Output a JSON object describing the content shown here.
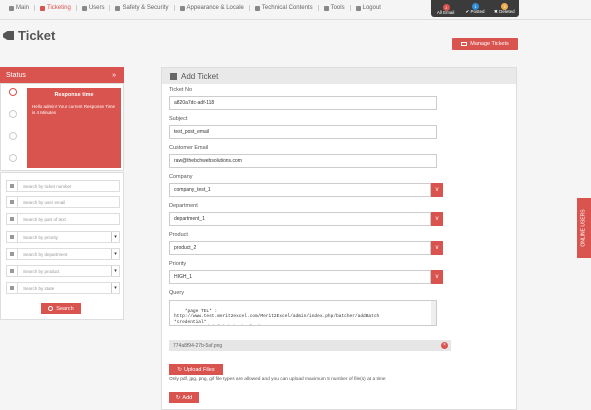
{
  "nav": {
    "items": [
      {
        "label": "Main",
        "icon": "gear-icon",
        "active": false
      },
      {
        "label": "Ticketing",
        "icon": "ticket-icon",
        "active": true
      },
      {
        "label": "Users",
        "icon": "users-icon",
        "active": false
      },
      {
        "label": "Safety & Security",
        "icon": "lock-icon",
        "active": false
      },
      {
        "label": "Appearance & Locale",
        "icon": "pencil-icon",
        "active": false
      },
      {
        "label": "Technical Contents",
        "icon": "cloud-icon",
        "active": false
      },
      {
        "label": "Tools",
        "icon": "wrench-icon",
        "active": false
      },
      {
        "label": "Logout",
        "icon": "power-icon",
        "active": false
      }
    ]
  },
  "toolbox": {
    "items": [
      {
        "label": "All Email",
        "badge": "1",
        "badge_color": "#d9534f"
      },
      {
        "label": "✔ Posted",
        "badge": "1",
        "badge_color": "#2f8fd8"
      },
      {
        "label": "✖ Deleted",
        "badge": "1",
        "badge_color": "#f0ad4e"
      }
    ]
  },
  "page": {
    "title": "Ticket",
    "manage_button": "Manage Tickets"
  },
  "status": {
    "header": "Status",
    "collapse_glyph": "»",
    "response_title": "Response time",
    "response_text": "Hello admin! Your current Response Time is 4 Minutes"
  },
  "search": {
    "fields": [
      {
        "placeholder": "Search by ticket number",
        "dropdown": false,
        "icon": "file-icon"
      },
      {
        "placeholder": "Search by user email",
        "dropdown": false,
        "icon": "user-icon"
      },
      {
        "placeholder": "Search by part of text",
        "dropdown": false,
        "icon": "text-icon"
      },
      {
        "placeholder": "Search by priority",
        "dropdown": true,
        "icon": "list-icon"
      },
      {
        "placeholder": "Search by department",
        "dropdown": true,
        "icon": "arrows-icon"
      },
      {
        "placeholder": "Search by product",
        "dropdown": true,
        "icon": "eye-icon"
      },
      {
        "placeholder": "Search by state",
        "dropdown": true,
        "icon": "eye-icon"
      }
    ],
    "button_label": "Search"
  },
  "form": {
    "header": "Add Ticket",
    "ticket_no_label": "Ticket No",
    "ticket_no_value": "a820a7dc-adf-118",
    "subject_label": "Subject",
    "subject_value": "test_post_email",
    "email_label": "Customer Email",
    "email_value": "raw@thebchwebsolutions.com",
    "company_label": "Company",
    "company_value": "company_test_1",
    "department_label": "Department",
    "department_value": "department_1",
    "product_label": "Product",
    "product_value": "product_2",
    "priority_label": "Priority",
    "priority_value": "HIGH_1",
    "query_label": "Query",
    "query_value": "*page TEL* :\nhttp://www.test.merit2excel.com/Merit2Excel/admin/index.php/batcher/addBatch\n*credential*\nusername : admin@thebchwebsolutions.com",
    "attachment_name": "774a8f94-27b-5af.png",
    "upload_label": "Upload Files",
    "upload_note": "Only pdf, jpg, png, gif file types are allowed and you can upload maximum 5 number of file(s) at a time",
    "add_label": "Add"
  },
  "online_users": "ONLINE USERS",
  "colors": {
    "accent": "#d9534f",
    "toolbox_bg": "#3b3b3b"
  }
}
